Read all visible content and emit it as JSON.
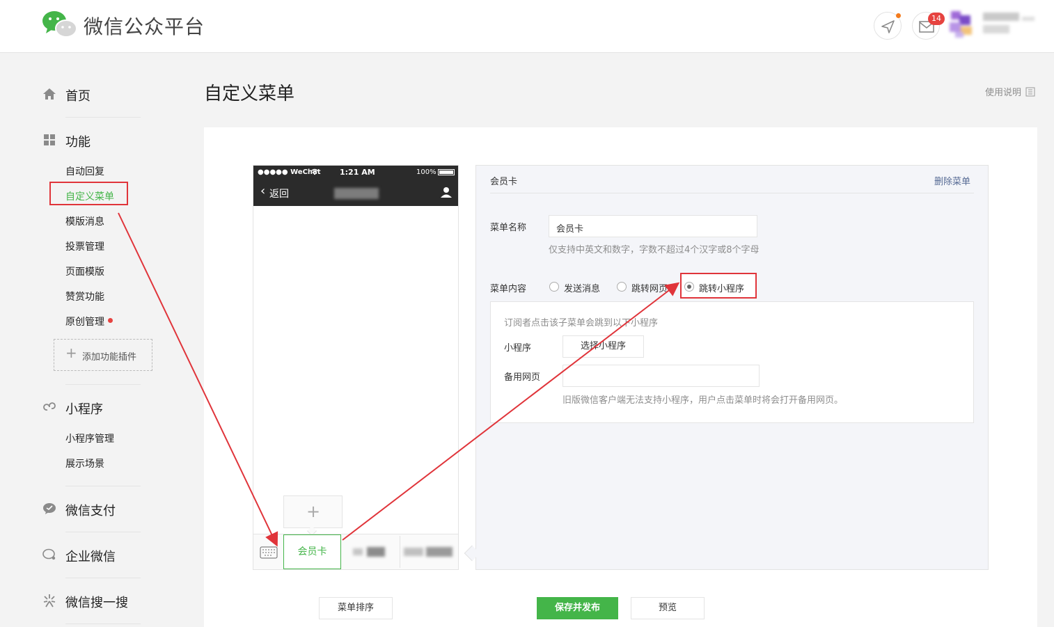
{
  "header": {
    "title": "微信公众平台",
    "message_count": "14"
  },
  "sidebar": {
    "home": "首页",
    "features": "功能",
    "feature_items": [
      "自动回复",
      "自定义菜单",
      "模版消息",
      "投票管理",
      "页面模版",
      "赞赏功能",
      "原创管理"
    ],
    "add_plugin": "添加功能插件",
    "miniprogram": "小程序",
    "miniprogram_items": [
      "小程序管理",
      "展示场景"
    ],
    "wechat_pay": "微信支付",
    "enterprise_wechat": "企业微信",
    "wechat_search": "微信搜一搜"
  },
  "page": {
    "title": "自定义菜单",
    "help_link": "使用说明"
  },
  "phone": {
    "carrier": "●●●●● WeChat",
    "time": "1:21 AM",
    "battery": "100%",
    "back": "返回",
    "menu_active": "会员卡",
    "add_symbol": "+"
  },
  "editor": {
    "heading": "会员卡",
    "delete": "删除菜单",
    "name_label": "菜单名称",
    "name_value": "会员卡",
    "name_hint": "仅支持中英文和数字，字数不超过4个汉字或8个字母",
    "content_label": "菜单内容",
    "options": [
      "发送消息",
      "跳转网页",
      "跳转小程序"
    ],
    "selected_option": "跳转小程序",
    "mp_desc": "订阅者点击该子菜单会跳到以下小程序",
    "mp_label": "小程序",
    "mp_button": "选择小程序",
    "backup_label": "备用网页",
    "backup_value": "",
    "backup_hint": "旧版微信客户端无法支持小程序，用户点击菜单时将会打开备用网页。"
  },
  "footer": {
    "sort": "菜单排序",
    "publish": "保存并发布",
    "preview": "预览"
  },
  "colors": {
    "accent": "#44b549",
    "annotation": "#e0343a",
    "badge": "#e64340"
  }
}
